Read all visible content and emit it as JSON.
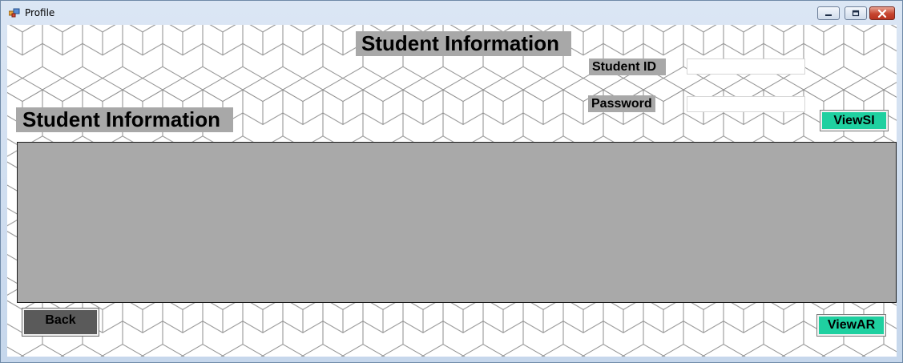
{
  "window": {
    "title": "Profile",
    "controls": [
      "minimize-icon",
      "maximize-icon",
      "close-icon"
    ]
  },
  "form": {
    "heading": "Student Information",
    "section_label": "Student Information",
    "student_id_label": "Student ID",
    "student_id_value": "",
    "password_label": "Password",
    "password_value": ""
  },
  "buttons": {
    "view_si": "ViewSI",
    "view_ar": "ViewAR",
    "back": "Back"
  },
  "grid": {
    "rows": []
  },
  "colors": {
    "accent_button": "#1fd0a0",
    "back_button": "#5a5a5a",
    "label_background": "#a8a8a8",
    "grid_background": "#a9a9a9"
  }
}
